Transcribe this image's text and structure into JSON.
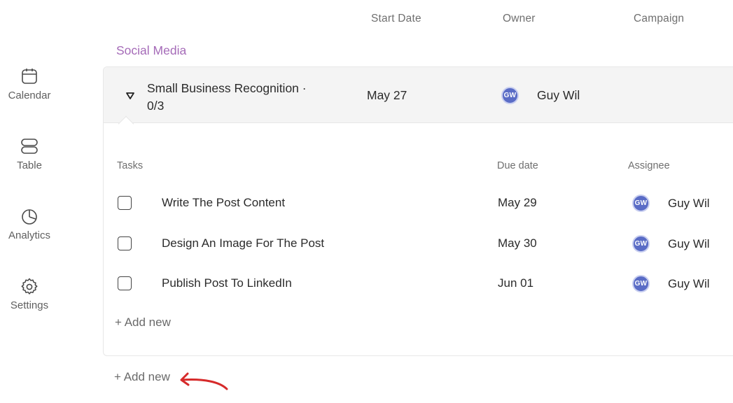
{
  "sidebar": {
    "items": [
      {
        "label": "Calendar",
        "icon": "calendar-icon"
      },
      {
        "label": "Table",
        "icon": "table-icon"
      },
      {
        "label": "Analytics",
        "icon": "analytics-icon"
      },
      {
        "label": "Settings",
        "icon": "settings-icon"
      }
    ]
  },
  "columns": {
    "start_date": "Start Date",
    "owner": "Owner",
    "campaign": "Campaign"
  },
  "group": {
    "title": "Social Media",
    "color": "#a56bb8",
    "item": {
      "title": "Small Business Recognition ·",
      "progress": "0/3",
      "start_date": "May 27",
      "owner_initials": "GW",
      "owner_name": "Guy Wil"
    },
    "subtable": {
      "headers": {
        "tasks": "Tasks",
        "due_date": "Due date",
        "assignee": "Assignee"
      },
      "rows": [
        {
          "name": "Write The Post Content",
          "due": "May 29",
          "initials": "GW",
          "assignee": "Guy Wil"
        },
        {
          "name": "Design An Image For The Post",
          "due": "May 30",
          "initials": "GW",
          "assignee": "Guy Wil"
        },
        {
          "name": "Publish Post To LinkedIn",
          "due": "Jun 01",
          "initials": "GW",
          "assignee": "Guy Wil"
        }
      ],
      "add_new": "+ Add new"
    }
  },
  "add_new": "+ Add new",
  "annotation_color": "#d62a2a"
}
